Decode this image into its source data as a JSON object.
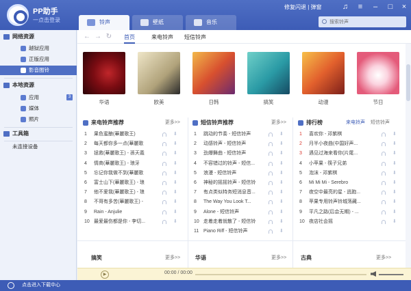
{
  "app": {
    "name": "PP助手",
    "login_prompt": "一点击登录"
  },
  "top_tabs": [
    {
      "label": "铃声"
    },
    {
      "label": "壁纸"
    },
    {
      "label": "音乐"
    }
  ],
  "header": {
    "fix_flash": "修复闪退 | 弹窗"
  },
  "search": {
    "placeholder": "搜索铃声"
  },
  "sidebar": {
    "online_title": "网络资源",
    "online_items": [
      {
        "label": "越狱应用"
      },
      {
        "label": "正版应用"
      },
      {
        "label": "影音图铃"
      }
    ],
    "local_title": "本地资源",
    "local_items": [
      {
        "label": "应用",
        "badge": "3"
      },
      {
        "label": "媒体"
      },
      {
        "label": "照片"
      }
    ],
    "toolbox": "工具箱",
    "device": "未连接设备"
  },
  "footer": {
    "download_center": "点击进入下载中心"
  },
  "subnav": {
    "tabs": [
      {
        "label": "首页"
      },
      {
        "label": "来电铃声"
      },
      {
        "label": "短信铃声"
      }
    ]
  },
  "albums": [
    {
      "label": "华语"
    },
    {
      "label": "欧美"
    },
    {
      "label": "日韩"
    },
    {
      "label": "搞笑"
    },
    {
      "label": "动漫"
    },
    {
      "label": "节日"
    }
  ],
  "call_panel": {
    "title": "来电铃声推荐",
    "more": "更多>>",
    "rows": [
      {
        "num": "1",
        "title": "果色蜜酿(華麗歌王)"
      },
      {
        "num": "2",
        "title": "每天都你多一点(華麗歌"
      },
      {
        "num": "3",
        "title": "拯救(華麗歌王) - 孫天義"
      },
      {
        "num": "4",
        "title": "情商(華麗歌王) - 琅牙"
      },
      {
        "num": "5",
        "title": "忘记你我做不到(華麗歌"
      },
      {
        "num": "6",
        "title": "富士山下(華麗歌王) - 琅"
      },
      {
        "num": "7",
        "title": "他不爱我(華麗歌王) - 琅"
      },
      {
        "num": "8",
        "title": "不哥有多苦(華麗歌王) - "
      },
      {
        "num": "9",
        "title": "Rain - Anjulie"
      },
      {
        "num": "10",
        "title": "最爱最伤都是你 - 李切..."
      }
    ]
  },
  "sms_panel": {
    "title": "短信铃声推荐",
    "more": "更多>>",
    "rows": [
      {
        "num": "1",
        "title": "跳动的节奏 - 短信铃声"
      },
      {
        "num": "2",
        "title": "动感铃声 - 短信铃声"
      },
      {
        "num": "3",
        "title": "劲爆舞曲 - 短信铃声"
      },
      {
        "num": "4",
        "title": "不容错过的铃声 - 短信..."
      },
      {
        "num": "5",
        "title": "浪漫 - 短信铃声"
      },
      {
        "num": "6",
        "title": "神秘的摇摇铃声 - 短信铃"
      },
      {
        "num": "7",
        "title": "有点类似特务短消息音..."
      },
      {
        "num": "8",
        "title": "The Way You Look T..."
      },
      {
        "num": "9",
        "title": "Alone - 短信铃声"
      },
      {
        "num": "10",
        "title": "走着走着就散了 - 短信铃"
      },
      {
        "num": "11",
        "title": "Piano Riff - 短信铃声"
      }
    ]
  },
  "rank_panel": {
    "title": "排行榜",
    "tab_call": "来电铃声",
    "tab_sms": "短信铃声",
    "rows": [
      {
        "num": "1",
        "title": "喜欢你 - 邓紫棋"
      },
      {
        "num": "2",
        "title": "月半小夜曲(中国好声..."
      },
      {
        "num": "3",
        "title": "遇见过海来看你(片尾..."
      },
      {
        "num": "4",
        "title": "小苹果 - 筷子兄弟"
      },
      {
        "num": "5",
        "title": "泡沫 - 邓紫棋"
      },
      {
        "num": "6",
        "title": "Mi Mi Mi - Serebro"
      },
      {
        "num": "7",
        "title": "夜空中最亮的星 - 逃跑..."
      },
      {
        "num": "8",
        "title": "苹果专用铃声铃城荡藏..."
      },
      {
        "num": "9",
        "title": "平凡之路(后会无期) - ..."
      },
      {
        "num": "10",
        "title": "夜店社会摇"
      }
    ]
  },
  "bottom_sections": [
    {
      "title": "搞笑",
      "more": "更多>>"
    },
    {
      "title": "华语",
      "more": "更多>>"
    },
    {
      "title": "古典",
      "more": "更多>>"
    }
  ],
  "player": {
    "time": "00:00 / 00:00"
  },
  "colors": {
    "brand": "#3d5cb6",
    "player_bg": "#fbf4d5",
    "rank_highlight": "#d9342b"
  }
}
